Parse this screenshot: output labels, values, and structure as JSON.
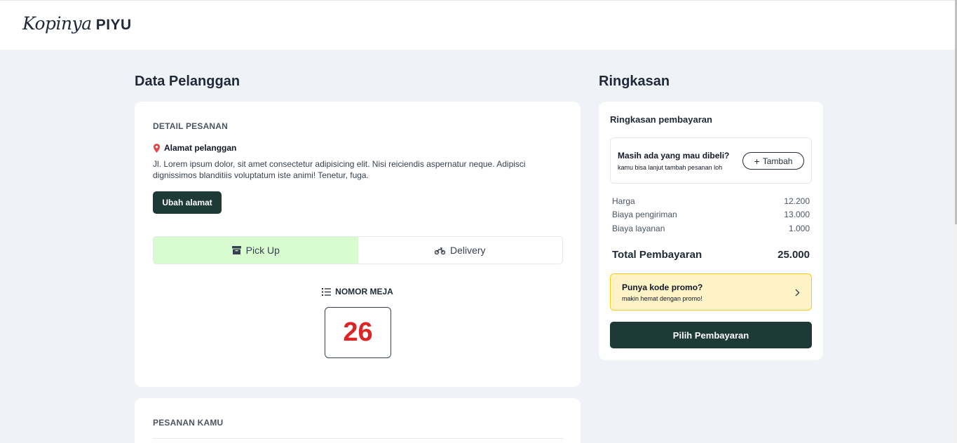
{
  "brand": {
    "script": "Kopinya",
    "bold": "PIYU"
  },
  "left": {
    "title": "Data Pelanggan",
    "detail": {
      "label": "DETAIL PESANAN",
      "address_title": "Alamat pelanggan",
      "address_text": "Jl. Lorem ipsum dolor, sit amet consectetur adipisicing elit. Nisi reiciendis aspernatur neque. Adipisci dignissimos blanditiis voluptatum iste animi! Tenetur, fuga.",
      "change_button": "Ubah alamat",
      "options": [
        {
          "label": "Pick Up",
          "icon": "archive-box-icon",
          "active": true
        },
        {
          "label": "Delivery",
          "icon": "motorbike-icon",
          "active": false
        }
      ],
      "table_label": "NOMOR MEJA",
      "table_number": "26"
    },
    "orders_label": "PESANAN KAMU"
  },
  "right": {
    "title": "Ringkasan",
    "subtitle": "Ringkasan pembayaran",
    "upsell": {
      "title": "Masih ada yang mau dibeli?",
      "text": "kamu bisa lanjut tambah pesanan loh",
      "button": "Tambah"
    },
    "rows": [
      {
        "label": "Harga",
        "value": "12.200"
      },
      {
        "label": "Biaya pengiriman",
        "value": "13.000"
      },
      {
        "label": "Biaya layanan",
        "value": "1.000"
      }
    ],
    "total_label": "Total Pembayaran",
    "total_value": "25.000",
    "promo": {
      "title": "Punya kode promo?",
      "text": "makin hemat dengan promo!"
    },
    "pay_button": "Pilih Pembayaran"
  },
  "colors": {
    "primary": "#1d3a37",
    "accent_red": "#dc2626",
    "pickup_bg": "#d9fbd0",
    "promo_bg": "#fef3c7",
    "promo_border": "#facc15"
  }
}
